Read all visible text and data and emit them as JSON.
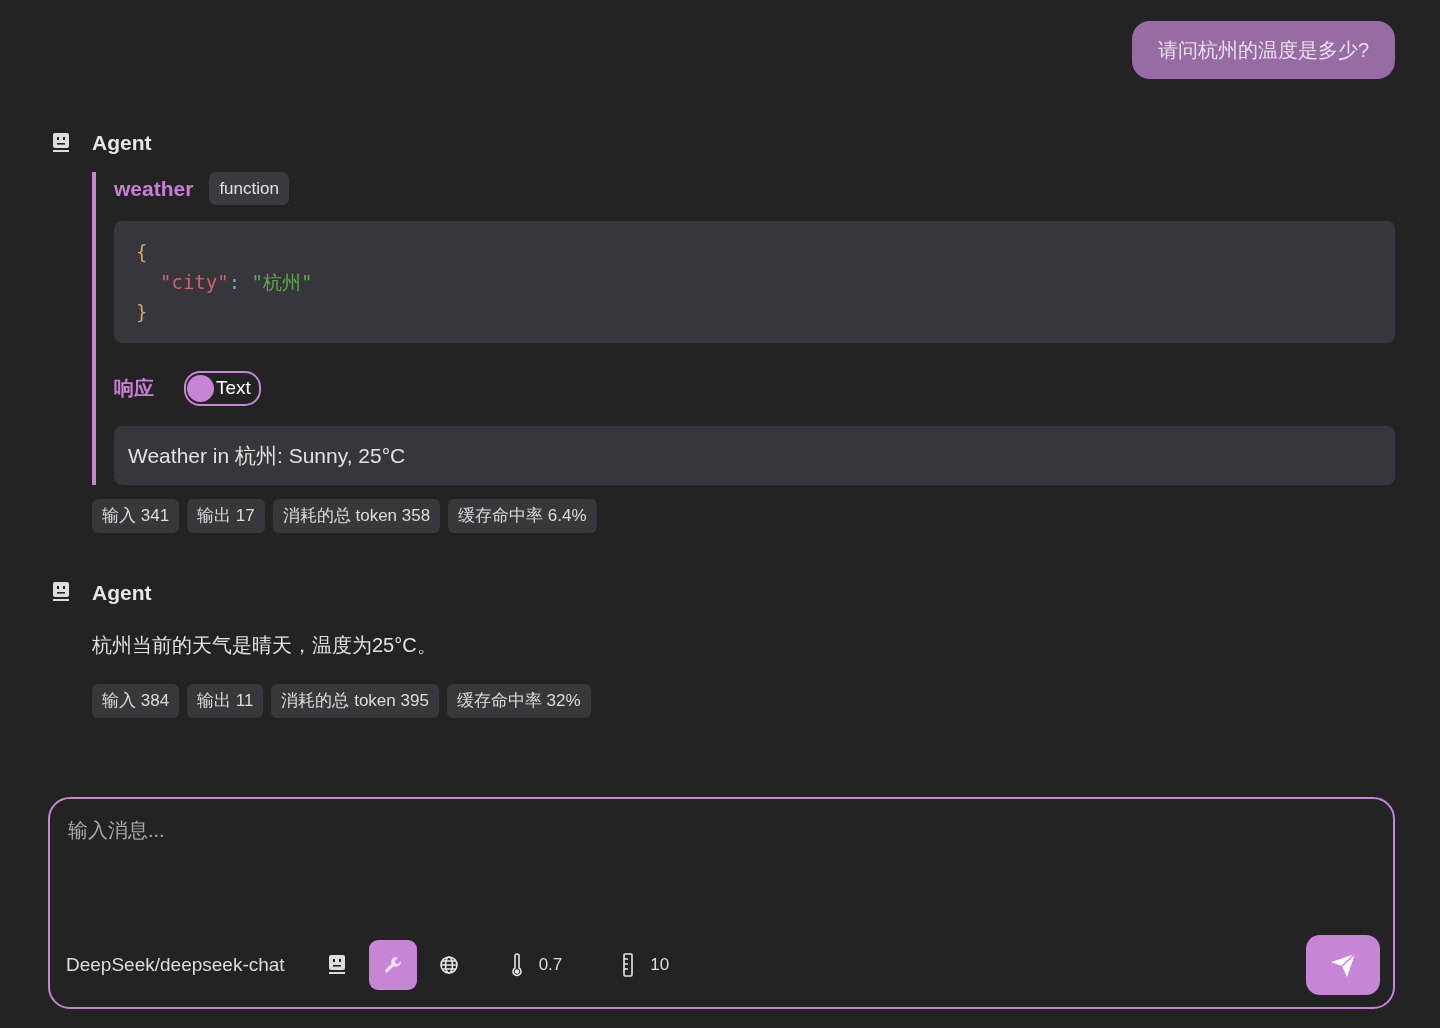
{
  "user_message": "请问杭州的温度是多少?",
  "messages": [
    {
      "kind": "tool",
      "author": "Agent",
      "tool_name": "weather",
      "tool_type": "function",
      "code": [
        [
          {
            "kind": "punct",
            "text": "{"
          }
        ],
        [
          {
            "kind": "key",
            "text": "\"city\""
          },
          {
            "kind": "colon",
            "text": ": "
          },
          {
            "kind": "string",
            "text": "\"杭州\""
          }
        ],
        [
          {
            "kind": "punct",
            "text": "}"
          }
        ]
      ],
      "response_label": "响应",
      "response_toggle": {
        "label": "Text",
        "selected": true
      },
      "response_text": "Weather in 杭州: Sunny, 25°C",
      "stats": [
        "输入 341",
        "输出 17",
        "消耗的总 token 358",
        "缓存命中率 6.4%"
      ]
    },
    {
      "kind": "text",
      "author": "Agent",
      "text": "杭州当前的天气是晴天，温度为25°C。",
      "stats": [
        "输入 384",
        "输出 11",
        "消耗的总 token 395",
        "缓存命中率 32%"
      ]
    }
  ],
  "composer": {
    "placeholder": "输入消息...",
    "model": "DeepSeek/deepseek-chat",
    "tools": [
      {
        "kind": "agent",
        "on": false
      },
      {
        "kind": "tools",
        "on": true
      },
      {
        "kind": "web",
        "on": false
      }
    ],
    "temperature": "0.7",
    "max_steps": "10"
  }
}
